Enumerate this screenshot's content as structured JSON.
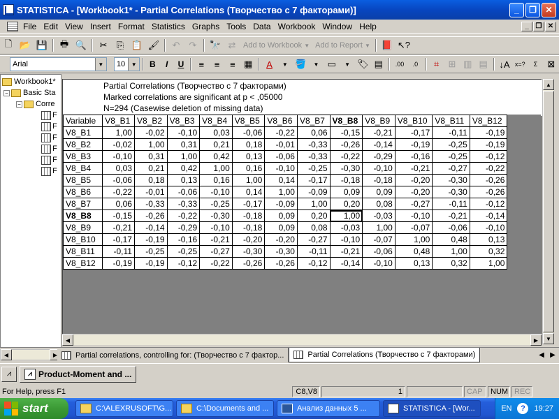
{
  "window": {
    "title": "STATISTICA - [Workbook1* - Partial Correlations (Творчество с 7 факторами)]",
    "controls": [
      "_",
      "❐",
      "✕"
    ]
  },
  "menubar": {
    "items": [
      "File",
      "Edit",
      "View",
      "Insert",
      "Format",
      "Statistics",
      "Graphs",
      "Tools",
      "Data",
      "Workbook",
      "Window",
      "Help"
    ],
    "mdi_controls": [
      "_",
      "❐",
      "✕"
    ]
  },
  "toolbar1": {
    "add_to_workbook": "Add to Workbook",
    "add_to_report": "Add to Report"
  },
  "toolbar2": {
    "font": "Arial",
    "size": "10",
    "bold": "B",
    "italic": "I",
    "underline": "U"
  },
  "tree": {
    "nodes": [
      {
        "label": "Workbook1*",
        "level": 0
      },
      {
        "label": "Basic Sta",
        "level": 1
      },
      {
        "label": "Corre",
        "level": 2
      },
      {
        "label": "F",
        "level": 3
      },
      {
        "label": "F",
        "level": 3
      },
      {
        "label": "F",
        "level": 3
      },
      {
        "label": "F",
        "level": 3
      },
      {
        "label": "F",
        "level": 3
      },
      {
        "label": "F",
        "level": 3
      }
    ]
  },
  "sheet": {
    "header_lines": [
      "Partial Correlations (Творчество с 7 факторами)",
      "Marked correlations are significant at p < ,05000",
      "N=294 (Casewise deletion of missing data)"
    ],
    "variable_header": "Variable",
    "columns": [
      "V8_B1",
      "V8_B2",
      "V8_B3",
      "V8_B4",
      "V8_B5",
      "V8_B6",
      "V8_B7",
      "V8_B8",
      "V8_B9",
      "V8_B10",
      "V8_B11",
      "V8_B12"
    ],
    "bold_column": "V8_B8",
    "rows": [
      {
        "name": "V8_B1",
        "values": [
          "1,00",
          "-0,02",
          "-0,10",
          "0,03",
          "-0,06",
          "-0,22",
          "0,06",
          "-0,15",
          "-0,21",
          "-0,17",
          "-0,11",
          "-0,19"
        ]
      },
      {
        "name": "V8_B2",
        "values": [
          "-0,02",
          "1,00",
          "0,31",
          "0,21",
          "0,18",
          "-0,01",
          "-0,33",
          "-0,26",
          "-0,14",
          "-0,19",
          "-0,25",
          "-0,19"
        ]
      },
      {
        "name": "V8_B3",
        "values": [
          "-0,10",
          "0,31",
          "1,00",
          "0,42",
          "0,13",
          "-0,06",
          "-0,33",
          "-0,22",
          "-0,29",
          "-0,16",
          "-0,25",
          "-0,12"
        ]
      },
      {
        "name": "V8_B4",
        "values": [
          "0,03",
          "0,21",
          "0,42",
          "1,00",
          "0,16",
          "-0,10",
          "-0,25",
          "-0,30",
          "-0,10",
          "-0,21",
          "-0,27",
          "-0,22"
        ]
      },
      {
        "name": "V8_B5",
        "values": [
          "-0,06",
          "0,18",
          "0,13",
          "0,16",
          "1,00",
          "0,14",
          "-0,17",
          "-0,18",
          "-0,18",
          "-0,20",
          "-0,30",
          "-0,26"
        ]
      },
      {
        "name": "V8_B6",
        "values": [
          "-0,22",
          "-0,01",
          "-0,06",
          "-0,10",
          "0,14",
          "1,00",
          "-0,09",
          "0,09",
          "0,09",
          "-0,20",
          "-0,30",
          "-0,26"
        ]
      },
      {
        "name": "V8_B7",
        "values": [
          "0,06",
          "-0,33",
          "-0,33",
          "-0,25",
          "-0,17",
          "-0,09",
          "1,00",
          "0,20",
          "0,08",
          "-0,27",
          "-0,11",
          "-0,12"
        ]
      },
      {
        "name": "V8_B8",
        "values": [
          "-0,15",
          "-0,26",
          "-0,22",
          "-0,30",
          "-0,18",
          "0,09",
          "0,20",
          "1,00",
          "-0,03",
          "-0,10",
          "-0,21",
          "-0,14"
        ]
      },
      {
        "name": "V8_B9",
        "values": [
          "-0,21",
          "-0,14",
          "-0,29",
          "-0,10",
          "-0,18",
          "0,09",
          "0,08",
          "-0,03",
          "1,00",
          "-0,07",
          "-0,06",
          "-0,10"
        ]
      },
      {
        "name": "V8_B10",
        "values": [
          "-0,17",
          "-0,19",
          "-0,16",
          "-0,21",
          "-0,20",
          "-0,20",
          "-0,27",
          "-0,10",
          "-0,07",
          "1,00",
          "0,48",
          "0,13"
        ]
      },
      {
        "name": "V8_B11",
        "values": [
          "-0,11",
          "-0,25",
          "-0,25",
          "-0,27",
          "-0,30",
          "-0,30",
          "-0,11",
          "-0,21",
          "-0,06",
          "0,48",
          "1,00",
          "0,32"
        ]
      },
      {
        "name": "V8_B12",
        "values": [
          "-0,19",
          "-0,19",
          "-0,12",
          "-0,22",
          "-0,26",
          "-0,26",
          "-0,12",
          "-0,14",
          "-0,10",
          "0,13",
          "0,32",
          "1,00"
        ]
      }
    ]
  },
  "sheet_tabs": [
    {
      "label": "Partial correlations, controlling for: (Творчество с 7 фактор...",
      "active": false
    },
    {
      "label": "Partial Correlations (Творчество с 7 факторами)",
      "active": true
    }
  ],
  "workbook_bar": {
    "item": "Product-Moment and ..."
  },
  "statusbar": {
    "help": "For Help, press F1",
    "cell": "C8,V8",
    "count": "1",
    "cap": "CAP",
    "num": "NUM",
    "rec": "REC"
  },
  "taskbar": {
    "start": "start",
    "tasks": [
      {
        "label": "C:\\ALEXRUSOFT\\G...",
        "icon": "folder"
      },
      {
        "label": "C:\\Documents and ...",
        "icon": "folder"
      },
      {
        "label": "Анализ данных 5 ...",
        "icon": "word"
      },
      {
        "label": "STATISTICA - [Wor...",
        "icon": "stat",
        "active": true
      }
    ],
    "lang": "EN",
    "time": "19:27"
  }
}
